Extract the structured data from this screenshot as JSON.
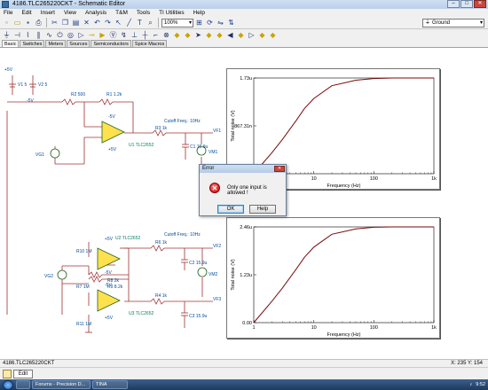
{
  "window": {
    "title": "4186.TLC265220CKT - Schematic Editor",
    "buttons": {
      "min": "–",
      "max": "□",
      "close": "✕"
    }
  },
  "menu": [
    "File",
    "Edit",
    "Insert",
    "View",
    "Analysis",
    "T&M",
    "Tools",
    "TI Utilities",
    "Help"
  ],
  "toolbar": {
    "zoom": "100%",
    "ground_select": "Ground",
    "icons": [
      "new-icon",
      "open-icon",
      "save-icon",
      "print-icon",
      "cut-icon",
      "copy-icon",
      "paste-icon",
      "delete-icon",
      "undo-icon",
      "redo-icon",
      "pointer-icon",
      "wire-icon",
      "text-icon",
      "zoom-icon"
    ]
  },
  "component_icons": [
    "ground-icon",
    "battery-icon",
    "resistor-icon",
    "capacitor-icon",
    "inductor-icon",
    "switch-icon",
    "source-icon",
    "diode-icon",
    "transistor-icon",
    "opamp-icon",
    "meter-icon",
    "probe-icon"
  ],
  "tabs": [
    "Basic",
    "Switches",
    "Meters",
    "Sources",
    "Semiconductors",
    "Spice Macros"
  ],
  "schematic": {
    "supply": {
      "pos": "+5V",
      "neg": "-5V",
      "v1": "V1 5",
      "v2": "V2 5"
    },
    "top": {
      "r2": "R2 500",
      "r1": "R1 1.2k",
      "neg5": "-5V",
      "pos5": "+5V",
      "opamp": "U1 TLC2652",
      "r3": "R3 1k",
      "cutoff": "Cutoff Freq.: 10Hz",
      "c1": "C1 15.9u",
      "vf1": "VF1",
      "vm1": "VM1",
      "vg1": "VG1"
    },
    "bottom": {
      "pos5a": "+5V",
      "u2": "U2 TLC2652",
      "neg5a": "-5V",
      "r10": "R10 1M",
      "r6": "R6 1k",
      "cutoff": "Cutoff Freq.: 10Hz",
      "c2": "C2 15.9u",
      "vf2": "VF2",
      "r8": "R8 2k",
      "r9": "R9 8.2k",
      "r7": "R7 1M",
      "vm2": "VM2",
      "vg2": "VG2",
      "neg5b": "-5V",
      "u3": "U3 TLC2652",
      "r4": "R4 1k",
      "pos5b": "+5V",
      "r11": "R11 1M",
      "c3": "C3 15.9u",
      "vf3": "VF3"
    }
  },
  "graph1": {
    "ylabel": "Total noise (V)",
    "xlabel": "Frequency (Hz)",
    "yticks": [
      "1.73u",
      "867.31n",
      "0.00"
    ],
    "xticks": [
      "1",
      "10",
      "100",
      "1k"
    ]
  },
  "graph2": {
    "ylabel": "Total noise (V)",
    "xlabel": "Frequency (Hz)",
    "yticks": [
      "2.46u",
      "1.23u",
      "0.00"
    ],
    "xticks": [
      "1",
      "10",
      "100",
      "1k"
    ]
  },
  "chart_data": [
    {
      "type": "line",
      "xlabel": "Frequency (Hz)",
      "ylabel": "Total noise (V)",
      "x": [
        1,
        2,
        3,
        5,
        7,
        10,
        20,
        50,
        100,
        200,
        500,
        1000
      ],
      "y": [
        0.0,
        0.38,
        0.62,
        0.95,
        1.18,
        1.36,
        1.59,
        1.69,
        1.72,
        1.73,
        1.73,
        1.73
      ],
      "ylim": [
        0,
        1.73
      ],
      "xlim": [
        1,
        1000
      ],
      "xscale": "log",
      "grid": false
    },
    {
      "type": "line",
      "xlabel": "Frequency (Hz)",
      "ylabel": "Total noise (V)",
      "x": [
        1,
        2,
        3,
        5,
        7,
        10,
        20,
        50,
        100,
        200,
        500,
        1000
      ],
      "y": [
        0.0,
        0.55,
        0.89,
        1.36,
        1.68,
        1.94,
        2.27,
        2.41,
        2.45,
        2.46,
        2.46,
        2.46
      ],
      "ylim": [
        0,
        2.46
      ],
      "xlim": [
        1,
        1000
      ],
      "xscale": "log",
      "grid": false
    }
  ],
  "dialog": {
    "title": "Error",
    "message": "Only one input is allowed !",
    "ok": "OK",
    "help": "Help",
    "icon": "error-icon"
  },
  "status": {
    "name": "4186.TLC265220CKT",
    "coords": "X: 235 Y: 154"
  },
  "docbar": {
    "label": "Edit"
  },
  "taskbar": {
    "items": [
      "",
      "Forums - Precision D...",
      "TINA"
    ],
    "time": "9:52"
  }
}
